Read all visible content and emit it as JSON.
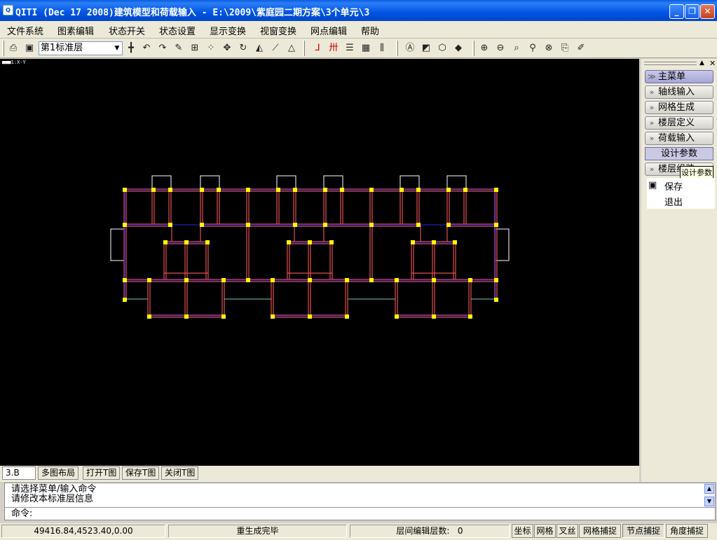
{
  "window": {
    "title": "QITI (Dec 17 2008)建筑模型和荷载输入 - E:\\2009\\紫庭园二期方案\\3个单元\\3",
    "icon": "app-icon"
  },
  "menu": [
    "文件系统",
    "图素编辑",
    "状态开关",
    "状态设置",
    "显示变换",
    "视窗变换",
    "网点编辑",
    "帮助"
  ],
  "toolbar": {
    "floor": "第1标准层"
  },
  "canvas": {
    "view_label": "1:X-Y"
  },
  "panel": {
    "items": [
      "主菜单",
      "轴线输入",
      "网格生成",
      "楼层定义",
      "荷载输入",
      "设计参数",
      "楼层组装"
    ],
    "tooltip": "设计参数",
    "submenu": [
      "保存",
      "退出"
    ]
  },
  "tabs": [
    "3.B",
    "多图布局",
    "打开T图",
    "保存T图",
    "关闭T图"
  ],
  "command": {
    "line1": "请选择菜单/输入命令",
    "line2": "请修改本标准层信息",
    "prompt": "命令:"
  },
  "status": {
    "coords": "49416.84,4523.40,0.00",
    "message": "重生成完毕",
    "layer_label": "层间编辑层数:",
    "layer_value": "0"
  },
  "toggles": [
    "坐标",
    "网格",
    "叉丝",
    "网格捕捉",
    "节点捕捉",
    "角度捕捉"
  ],
  "colors": {
    "canvas": "#000000",
    "beam": "#e05050",
    "axis": "#2020c0",
    "node": "#ffff00"
  }
}
